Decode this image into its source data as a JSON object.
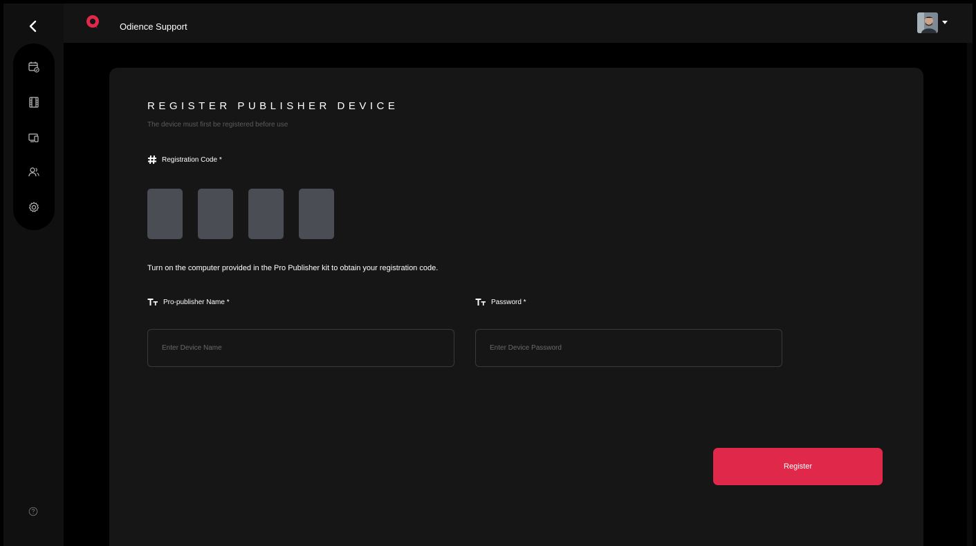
{
  "app": {
    "title": "Odience Support",
    "logo_text": "ODIENCE"
  },
  "sidebar": {
    "back_icon": "chevron-left-icon",
    "items": [
      {
        "name": "events",
        "icon": "calendar-check-icon"
      },
      {
        "name": "media",
        "icon": "film-icon"
      },
      {
        "name": "devices",
        "icon": "devices-icon"
      },
      {
        "name": "users",
        "icon": "users-icon"
      },
      {
        "name": "settings",
        "icon": "gear-icon"
      }
    ],
    "help_icon": "help-circle-icon"
  },
  "form": {
    "title": "REGISTER PUBLISHER DEVICE",
    "subtitle": "The device must first be registered before use",
    "registration_code_label": "Registration Code *",
    "code_boxes": [
      "",
      "",
      "",
      ""
    ],
    "hint": "Turn on the computer provided in the Pro Publisher kit to obtain your registration code.",
    "name_label": "Pro-publisher Name *",
    "name_placeholder": "Enter Device Name",
    "password_label": "Password *",
    "password_placeholder": "Enter Device Password",
    "register_label": "Register"
  },
  "colors": {
    "accent": "#e0294a",
    "card": "#161616",
    "code_box": "#4a4d54",
    "muted_text": "#5c5c5c"
  }
}
